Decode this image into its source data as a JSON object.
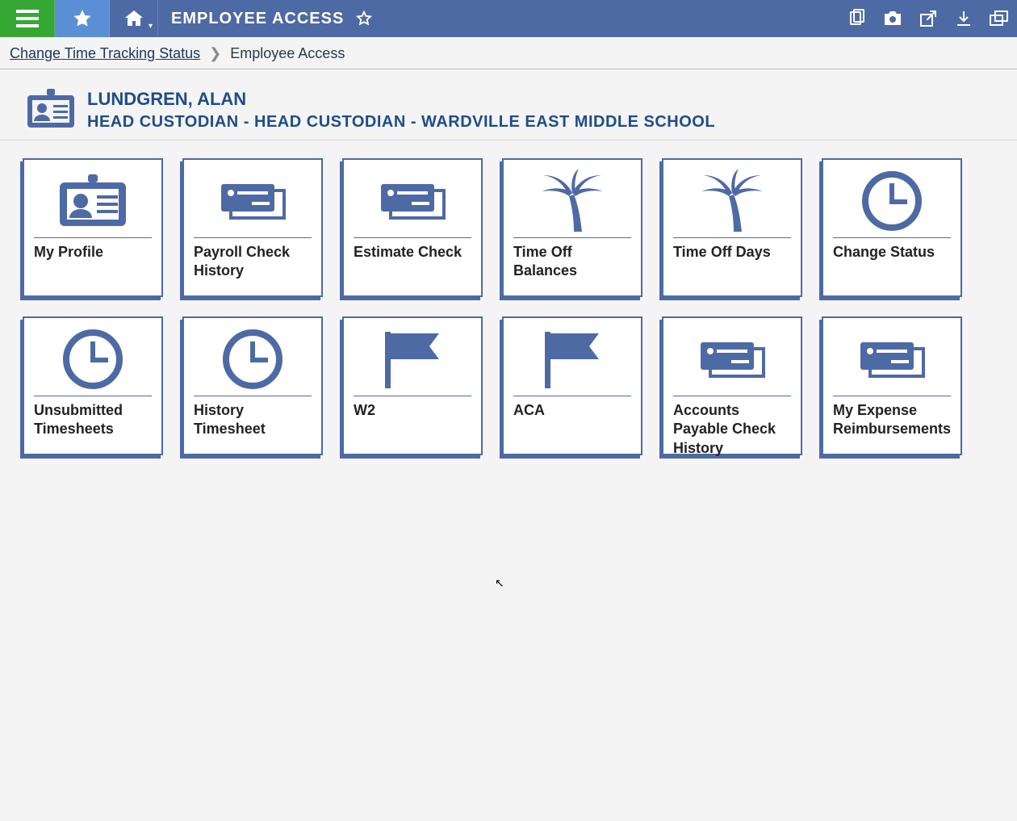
{
  "topbar": {
    "title": "EMPLOYEE ACCESS"
  },
  "breadcrumb": {
    "link": "Change Time Tracking Status",
    "current": "Employee Access"
  },
  "user": {
    "name": "LUNDGREN, ALAN",
    "role": "HEAD CUSTODIAN - HEAD CUSTODIAN - WARDVILLE EAST MIDDLE SCHOOL"
  },
  "tiles": [
    {
      "label": "My Profile",
      "icon": "badge"
    },
    {
      "label": "Payroll Check History",
      "icon": "check"
    },
    {
      "label": "Estimate Check",
      "icon": "check"
    },
    {
      "label": "Time Off Balances",
      "icon": "palm"
    },
    {
      "label": "Time Off Days",
      "icon": "palm"
    },
    {
      "label": "Change Status",
      "icon": "clock"
    },
    {
      "label": "Unsubmitted Timesheets",
      "icon": "clock"
    },
    {
      "label": "History Timesheet",
      "icon": "clock"
    },
    {
      "label": "W2",
      "icon": "flag"
    },
    {
      "label": "ACA",
      "icon": "flag"
    },
    {
      "label": "Accounts Payable Check History",
      "icon": "check"
    },
    {
      "label": "My Expense Reimbursements",
      "icon": "check"
    }
  ]
}
